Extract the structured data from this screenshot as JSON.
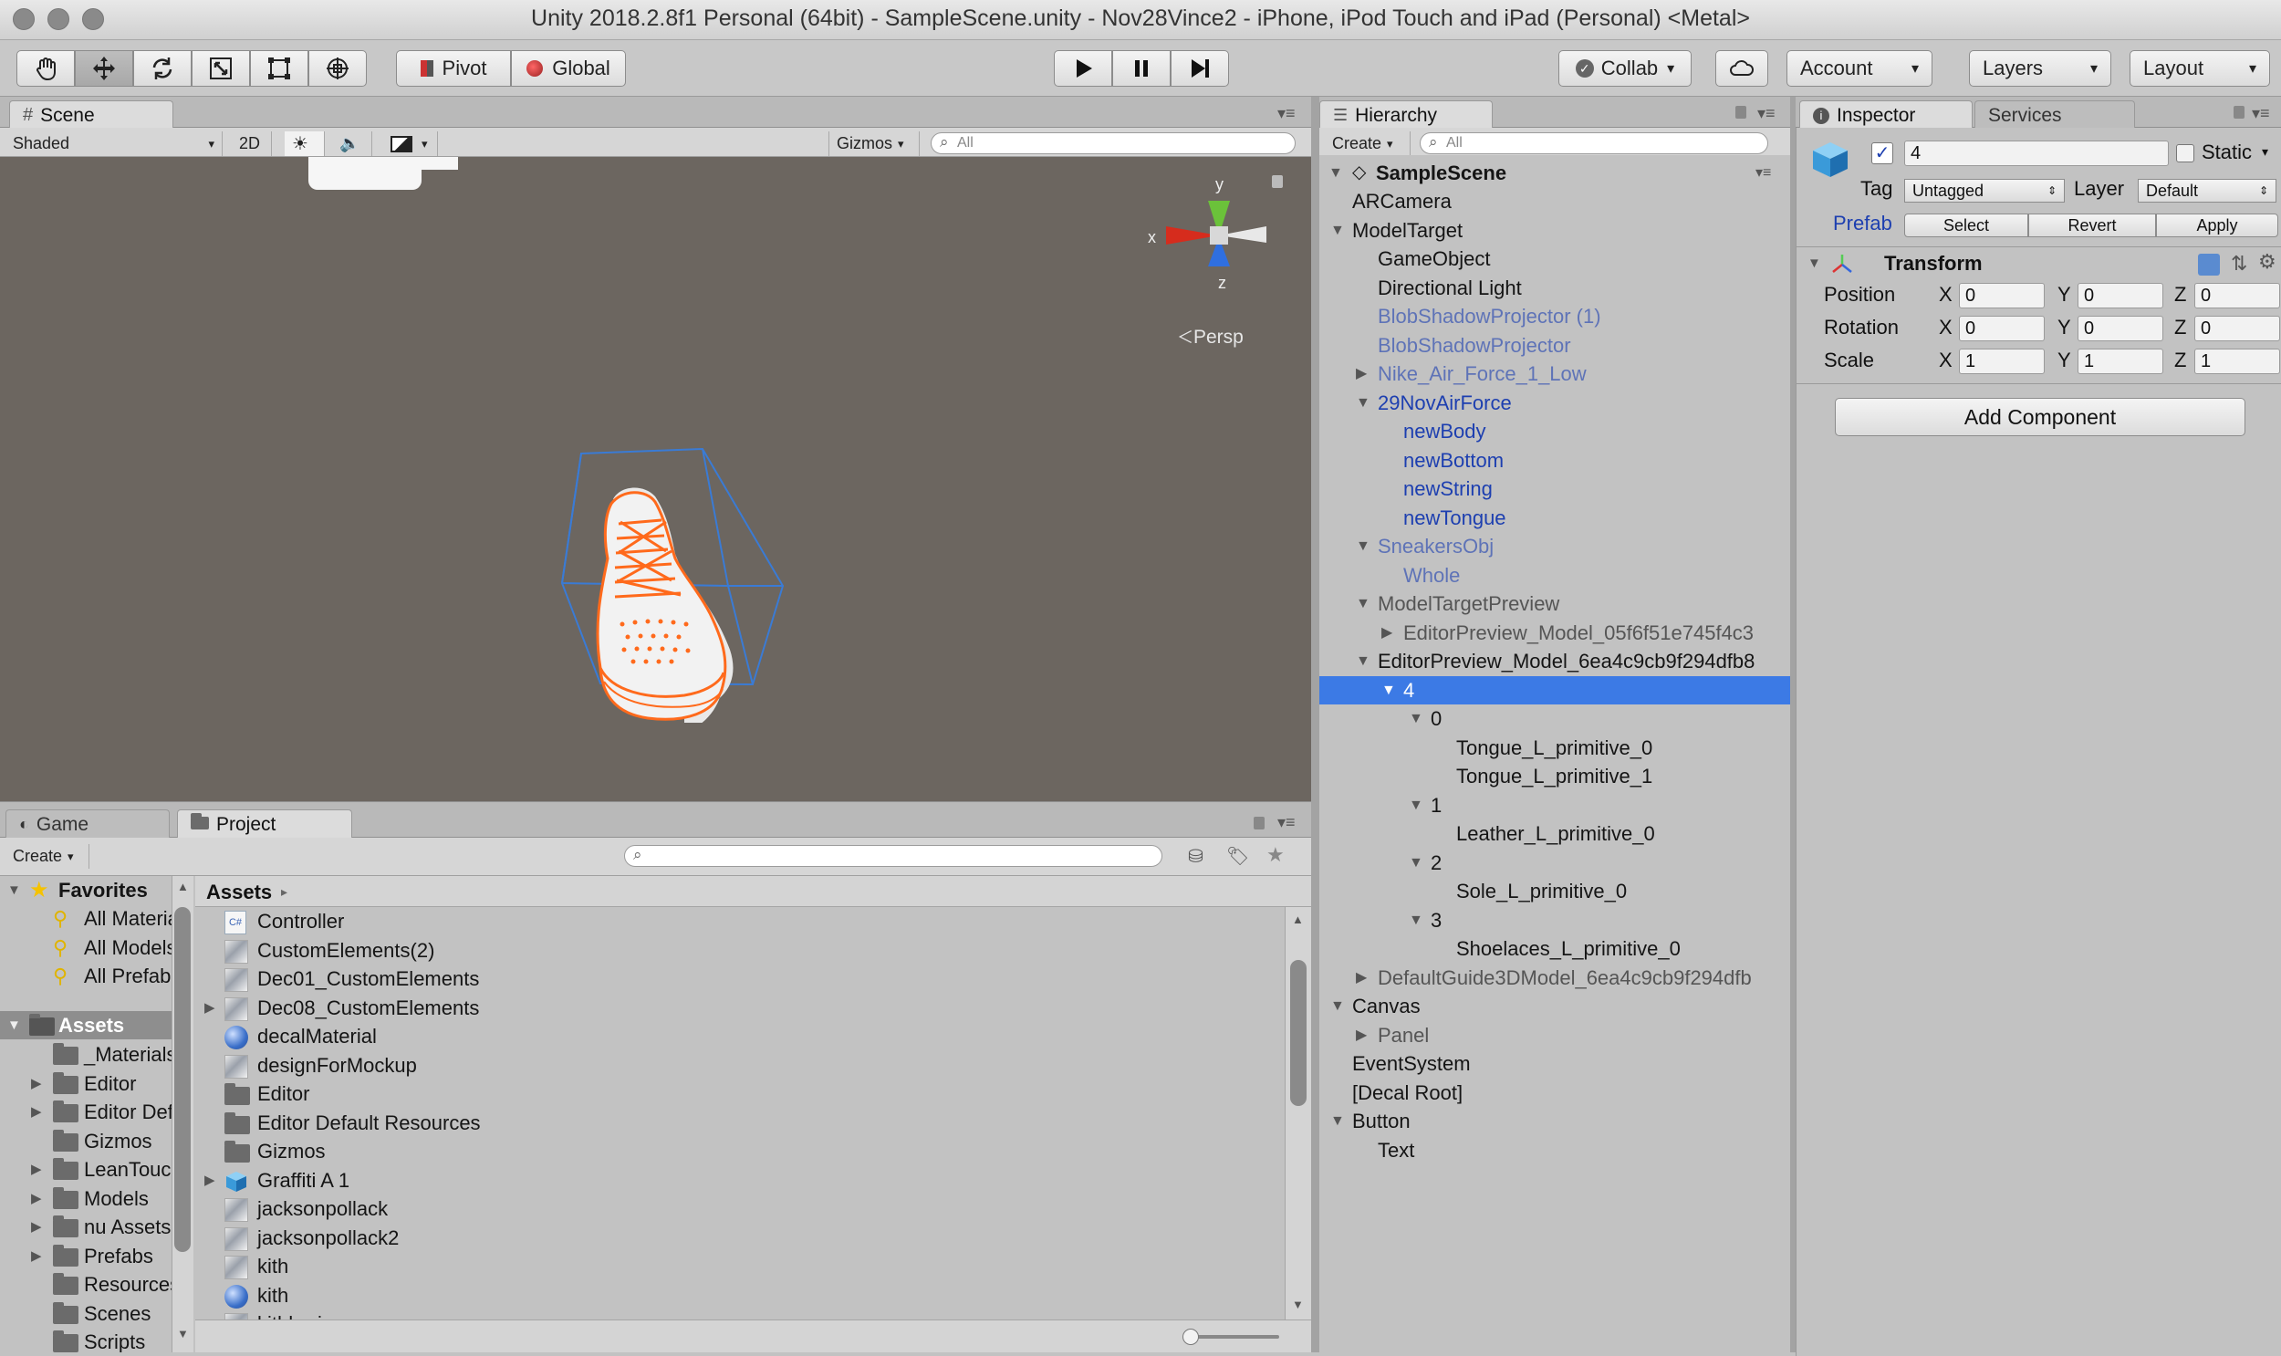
{
  "window": {
    "title": "Unity 2018.2.8f1 Personal (64bit) - SampleScene.unity - Nov28Vince2 - iPhone, iPod Touch and iPad (Personal) <Metal>"
  },
  "toolbar": {
    "pivot": "Pivot",
    "global": "Global",
    "collab": "Collab",
    "account": "Account",
    "layers": "Layers",
    "layout": "Layout"
  },
  "scene": {
    "tab": "Scene",
    "shading": "Shaded",
    "mode2d": "2D",
    "gizmos": "Gizmos",
    "search_placeholder": "All",
    "axis_x": "x",
    "axis_y": "y",
    "axis_z": "z",
    "persp": "Persp"
  },
  "hierarchy": {
    "tab": "Hierarchy",
    "create": "Create",
    "search_placeholder": "All",
    "scene_name": "SampleScene",
    "items": [
      {
        "label": "ARCamera",
        "depth": 0,
        "arrow": "",
        "style": "normal"
      },
      {
        "label": "ModelTarget",
        "depth": 0,
        "arrow": "open",
        "style": "normal"
      },
      {
        "label": "GameObject",
        "depth": 1,
        "arrow": "",
        "style": "normal"
      },
      {
        "label": "Directional Light",
        "depth": 1,
        "arrow": "",
        "style": "normal"
      },
      {
        "label": "BlobShadowProjector (1)",
        "depth": 1,
        "arrow": "",
        "style": "prefab-ghost"
      },
      {
        "label": "BlobShadowProjector",
        "depth": 1,
        "arrow": "",
        "style": "prefab-ghost"
      },
      {
        "label": "Nike_Air_Force_1_Low",
        "depth": 1,
        "arrow": "closed",
        "style": "prefab-ghost"
      },
      {
        "label": "29NovAirForce",
        "depth": 1,
        "arrow": "open",
        "style": "prefab"
      },
      {
        "label": "newBody",
        "depth": 2,
        "arrow": "",
        "style": "prefab"
      },
      {
        "label": "newBottom",
        "depth": 2,
        "arrow": "",
        "style": "prefab"
      },
      {
        "label": "newString",
        "depth": 2,
        "arrow": "",
        "style": "prefab"
      },
      {
        "label": "newTongue",
        "depth": 2,
        "arrow": "",
        "style": "prefab"
      },
      {
        "label": "SneakersObj",
        "depth": 1,
        "arrow": "open",
        "style": "prefab-ghost"
      },
      {
        "label": "Whole",
        "depth": 2,
        "arrow": "",
        "style": "prefab-ghost"
      },
      {
        "label": "ModelTargetPreview",
        "depth": 1,
        "arrow": "open",
        "style": "ghost"
      },
      {
        "label": "EditorPreview_Model_05f6f51e745f4c3",
        "depth": 2,
        "arrow": "closed",
        "style": "ghost"
      },
      {
        "label": "EditorPreview_Model_6ea4c9cb9f294dfb8",
        "depth": 1,
        "arrow": "open",
        "style": "normal"
      },
      {
        "label": "4",
        "depth": 2,
        "arrow": "open",
        "style": "selected"
      },
      {
        "label": "0",
        "depth": 3,
        "arrow": "open",
        "style": "normal"
      },
      {
        "label": "Tongue_L_primitive_0",
        "depth": 4,
        "arrow": "",
        "style": "normal"
      },
      {
        "label": "Tongue_L_primitive_1",
        "depth": 4,
        "arrow": "",
        "style": "normal"
      },
      {
        "label": "1",
        "depth": 3,
        "arrow": "open",
        "style": "normal"
      },
      {
        "label": "Leather_L_primitive_0",
        "depth": 4,
        "arrow": "",
        "style": "normal"
      },
      {
        "label": "2",
        "depth": 3,
        "arrow": "open",
        "style": "normal"
      },
      {
        "label": "Sole_L_primitive_0",
        "depth": 4,
        "arrow": "",
        "style": "normal"
      },
      {
        "label": "3",
        "depth": 3,
        "arrow": "open",
        "style": "normal"
      },
      {
        "label": "Shoelaces_L_primitive_0",
        "depth": 4,
        "arrow": "",
        "style": "normal"
      },
      {
        "label": "DefaultGuide3DModel_6ea4c9cb9f294dfb",
        "depth": 1,
        "arrow": "closed",
        "style": "ghost"
      },
      {
        "label": "Canvas",
        "depth": 0,
        "arrow": "open",
        "style": "normal"
      },
      {
        "label": "Panel",
        "depth": 1,
        "arrow": "closed",
        "style": "ghost"
      },
      {
        "label": "EventSystem",
        "depth": 0,
        "arrow": "",
        "style": "normal"
      },
      {
        "label": "[Decal Root]",
        "depth": 0,
        "arrow": "",
        "style": "normal"
      },
      {
        "label": "Button",
        "depth": 0,
        "arrow": "open",
        "style": "normal"
      },
      {
        "label": "Text",
        "depth": 1,
        "arrow": "",
        "style": "normal"
      }
    ]
  },
  "inspector": {
    "tab": "Inspector",
    "services_tab": "Services",
    "object_name": "4",
    "static_label": "Static",
    "tag_label": "Tag",
    "tag_value": "Untagged",
    "layer_label": "Layer",
    "layer_value": "Default",
    "prefab_label": "Prefab",
    "prefab_select": "Select",
    "prefab_revert": "Revert",
    "prefab_apply": "Apply",
    "transform_title": "Transform",
    "position_label": "Position",
    "rotation_label": "Rotation",
    "scale_label": "Scale",
    "axis_x": "X",
    "axis_y": "Y",
    "axis_z": "Z",
    "position": {
      "x": "0",
      "y": "0",
      "z": "0"
    },
    "rotation": {
      "x": "0",
      "y": "0",
      "z": "0"
    },
    "scale": {
      "x": "1",
      "y": "1",
      "z": "1"
    },
    "add_component": "Add Component"
  },
  "game_tab": "Game",
  "project": {
    "tab": "Project",
    "create": "Create",
    "assets_breadcrumb": "Assets",
    "favorites_label": "Favorites",
    "favorites": [
      "All Materials",
      "All Models",
      "All Prefabs"
    ],
    "assets_label": "Assets",
    "folders": [
      {
        "label": "_Materials",
        "arrow": false
      },
      {
        "label": "Editor",
        "arrow": true
      },
      {
        "label": "Editor Default Resources",
        "arrow": true
      },
      {
        "label": "Gizmos",
        "arrow": false
      },
      {
        "label": "LeanTouch",
        "arrow": true
      },
      {
        "label": "Models",
        "arrow": true
      },
      {
        "label": "nu Assets",
        "arrow": true
      },
      {
        "label": "Prefabs",
        "arrow": true
      },
      {
        "label": "Resources",
        "arrow": false
      },
      {
        "label": "Scenes",
        "arrow": false
      },
      {
        "label": "Scripts",
        "arrow": false
      }
    ],
    "files": [
      {
        "label": "Controller",
        "icon": "cs",
        "arrow": false
      },
      {
        "label": "CustomElements(2)",
        "icon": "thumb",
        "arrow": false
      },
      {
        "label": "Dec01_CustomElements",
        "icon": "thumb",
        "arrow": false
      },
      {
        "label": "Dec08_CustomElements",
        "icon": "thumb",
        "arrow": true
      },
      {
        "label": "decalMaterial",
        "icon": "sphere",
        "arrow": false
      },
      {
        "label": "designForMockup",
        "icon": "thumb",
        "arrow": false
      },
      {
        "label": "Editor",
        "icon": "folder",
        "arrow": false
      },
      {
        "label": "Editor Default Resources",
        "icon": "folder",
        "arrow": false
      },
      {
        "label": "Gizmos",
        "icon": "folder",
        "arrow": false
      },
      {
        "label": "Graffiti A 1",
        "icon": "cube",
        "arrow": true
      },
      {
        "label": "jacksonpollack",
        "icon": "thumb",
        "arrow": false
      },
      {
        "label": "jacksonpollack2",
        "icon": "thumb",
        "arrow": false
      },
      {
        "label": "kith",
        "icon": "thumb",
        "arrow": false
      },
      {
        "label": "kith",
        "icon": "sphere",
        "arrow": false
      },
      {
        "label": "kithhering",
        "icon": "thumb",
        "arrow": false
      }
    ]
  }
}
